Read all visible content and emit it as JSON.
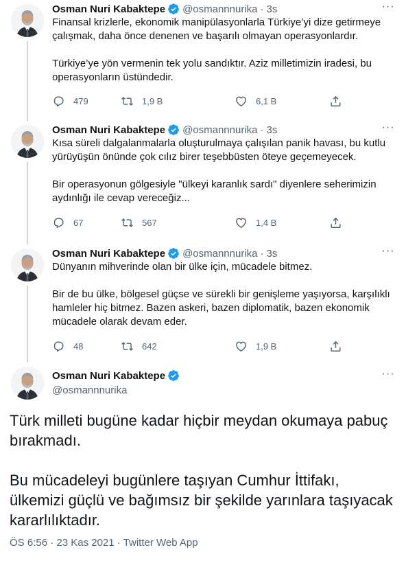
{
  "author": {
    "name": "Osman Nuri Kabaktepe",
    "handle": "@osmannnurika",
    "time": "3s"
  },
  "tweets": [
    {
      "paragraphs": [
        "Finansal krizlerle, ekonomik manipülasyonlarla Türkiye’yi dize getirmeye çalışmak, daha önce denenen ve başarılı olmayan operasyonlardır.",
        "Türkiye’ye yön vermenin tek yolu sandıktır. Aziz milletimizin iradesi, bu operasyonların üstündedir."
      ],
      "replies": "479",
      "retweets": "1,9 B",
      "likes": "6,1 B"
    },
    {
      "paragraphs": [
        "Kısa süreli dalgalanmalarla oluşturulmaya çalışılan panik havası, bu kutlu yürüyüşün önünde çok cılız birer teşebbüsten öteye geçemeyecek.",
        "Bir operasyonun gölgesiyle \"ülkeyi karanlık sardı\" diyenlere seherimizin aydınlığı ile cevap vereceğiz..."
      ],
      "replies": "67",
      "retweets": "567",
      "likes": "1,4 B"
    },
    {
      "paragraphs": [
        "Dünyanın mihverinde olan bir ülke için, mücadele bitmez.",
        "Bir de bu ülke, bölgesel güçse ve sürekli bir genişleme yaşıyorsa, karşılıklı hamleler hiç bitmez. Bazen askeri, bazen diplomatik, bazen ekonomik mücadele olarak devam eder."
      ],
      "replies": "48",
      "retweets": "642",
      "likes": "1,9 B"
    }
  ],
  "main_tweet": {
    "paragraphs": [
      "Türk milleti bugüne kadar hiçbir meydan okumaya pabuç bırakmadı.",
      "Bu mücadeleyi bugünlere taşıyan Cumhur İttifakı, ülkemizi güçlü ve bağımsız bir şekilde yarınlara taşıyacak kararlılıktadır."
    ],
    "meta": "ÖS 6:56 · 23 Kas 2021 · Twitter Web App"
  },
  "colors": {
    "verified": "#1d9bf0",
    "secondary_text": "#536471",
    "thread_line": "#cfd9de"
  },
  "icons": {
    "reply": "reply-icon",
    "retweet": "retweet-icon",
    "like": "heart-icon",
    "share": "share-icon",
    "verified": "verified-badge-icon",
    "more": "more-icon"
  }
}
